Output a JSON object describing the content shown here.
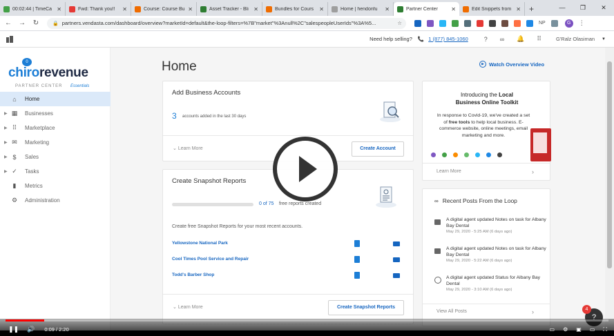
{
  "browser": {
    "tabs": [
      {
        "label": "00:02:44 | TimeCa",
        "color": "#43a047",
        "active": false
      },
      {
        "label": "Fwd: Thank you!!",
        "color": "#e53935",
        "active": false
      },
      {
        "label": "Course: Course Bu",
        "color": "#ef6c00",
        "active": false
      },
      {
        "label": "Asset Tracker - Bli",
        "color": "#2e7d32",
        "active": false
      },
      {
        "label": "Bundles for Cours",
        "color": "#ef6c00",
        "active": false
      },
      {
        "label": "Home | hendonfu",
        "color": "#9e9e9e",
        "active": false
      },
      {
        "label": "Partner Center",
        "color": "#2e7d32",
        "active": true
      },
      {
        "label": "Edit Snippets from",
        "color": "#ef6c00",
        "active": false
      }
    ],
    "url": "partners.vendasta.com/dashboard/overview?marketId=default&the-loop-filters=%7B\"market\"%3Anull%2C\"salespeopleUserIds\"%3A%5...",
    "extension_label": "NP",
    "profile_initial": "G"
  },
  "app_top": {
    "help_text": "Need help selling?",
    "phone": "1 (877) 845-1060",
    "user_name": "G'Ralz Olasiman"
  },
  "sidebar": {
    "brand_part1": "chiro",
    "brand_part2": "revenue",
    "brand_bubble": "0",
    "subtitle": "PARTNER CENTER",
    "edition": "Essentials",
    "items": [
      {
        "label": "Home",
        "icon": "home-icon",
        "glyph": "⌂",
        "active": true,
        "expandable": false
      },
      {
        "label": "Businesses",
        "icon": "building-icon",
        "glyph": "▦",
        "active": false,
        "expandable": true
      },
      {
        "label": "Marketplace",
        "icon": "grid-icon",
        "glyph": "⠿",
        "active": false,
        "expandable": true
      },
      {
        "label": "Marketing",
        "icon": "mail-icon",
        "glyph": "✉",
        "active": false,
        "expandable": true
      },
      {
        "label": "Sales",
        "icon": "dollar-icon",
        "glyph": "$",
        "active": false,
        "expandable": true
      },
      {
        "label": "Tasks",
        "icon": "check-circle-icon",
        "glyph": "✓",
        "active": false,
        "expandable": true
      },
      {
        "label": "Metrics",
        "icon": "bar-chart-icon",
        "glyph": "▮",
        "active": false,
        "expandable": false
      },
      {
        "label": "Administration",
        "icon": "gear-icon",
        "glyph": "⚙",
        "active": false,
        "expandable": false
      }
    ]
  },
  "main": {
    "title": "Home",
    "watch_label": "Watch Overview Video",
    "add_accounts": {
      "title": "Add Business Accounts",
      "count": "3",
      "note": "accounts added in the last 30 days",
      "learn_more": "Learn More",
      "button": "Create Account"
    },
    "snapshot": {
      "title": "Create Snapshot Reports",
      "progress_count": "0 of 75",
      "progress_note": "free reports created",
      "progress_fraction": 0,
      "description": "Create free Snapshot Reports for your most recent accounts.",
      "rows": [
        "Yellowstone National Park",
        "Cool Times Pool Service and Repair",
        "Todd's Barber Shop"
      ],
      "learn_more": "Learn More",
      "button": "Create Snapshot Reports"
    },
    "toolkit": {
      "title_line1": "Introducing the",
      "title_bold1": "Local",
      "title_line2": "Business Online Toolkit",
      "body_1": "In response to Covid-19, we've created a set of",
      "body_bold": "free tools",
      "body_2": "to help local business. E-commerce website, online meetings, email marketing and more.",
      "learn_more": "Learn More",
      "dot_colors": [
        "#7e57c2",
        "#43a047",
        "#fb8c00",
        "#66bb6a",
        "#29b6f6",
        "#1e88e5",
        "#424242"
      ]
    },
    "posts": {
      "title": "Recent Posts From the Loop",
      "items": [
        {
          "text": "A digital agent updated Notes on task for Albany Bay Dental",
          "date": "May 29, 2020 - 5:25 AM (6 days ago)",
          "icon": "note-icon"
        },
        {
          "text": "A digital agent updated Notes on task for Albany Bay Dental",
          "date": "May 29, 2020 - 5:22 AM (6 days ago)",
          "icon": "note-icon"
        },
        {
          "text": "A digital agent updated Status for Albany Bay Dental",
          "date": "May 29, 2020 - 3:10 AM (6 days ago)",
          "icon": "check-circle-icon"
        }
      ],
      "view_all": "View All Posts"
    }
  },
  "video": {
    "time": "0:09 / 2:20",
    "progress_fraction": 0.064,
    "chat_badge": "4",
    "chat_glyph": "?"
  }
}
